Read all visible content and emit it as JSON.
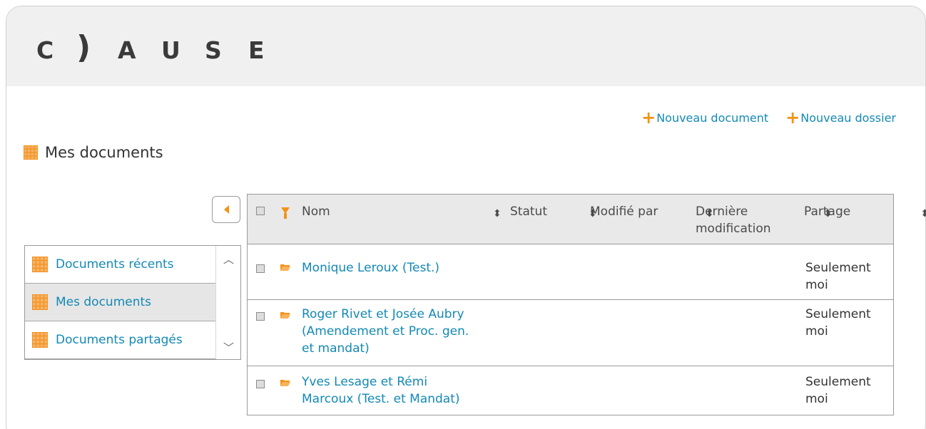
{
  "app": {
    "logo_parts": [
      "C",
      ")",
      "A",
      "U",
      "S",
      "E"
    ]
  },
  "actions": {
    "new_document": "Nouveau document",
    "new_folder": "Nouveau dossier"
  },
  "page": {
    "title": "Mes documents"
  },
  "sidebar": {
    "items": [
      {
        "label": "Documents récents",
        "active": false
      },
      {
        "label": "Mes documents",
        "active": true
      },
      {
        "label": "Documents partagés",
        "active": false
      }
    ]
  },
  "table": {
    "columns": {
      "name": "Nom",
      "status": "Statut",
      "modified_by": "Modifié par",
      "last_modified_1": "Dernière",
      "last_modified_2": "modification",
      "sharing": "Partage"
    },
    "rows": [
      {
        "name_lines": [
          "Monique Leroux (Test.)"
        ],
        "share_lines": [
          "Seulement",
          "moi"
        ]
      },
      {
        "name_lines": [
          "Roger Rivet et Josée Aubry",
          "(Amendement et Proc. gen.",
          "et mandat)"
        ],
        "share_lines": [
          "Seulement",
          "moi"
        ]
      },
      {
        "name_lines": [
          "Yves Lesage et Rémi",
          "Marcoux (Test. et Mandat)"
        ],
        "share_lines": [
          "Seulement",
          "moi"
        ]
      }
    ]
  },
  "colors": {
    "accent_orange": "#f39217",
    "link_blue": "#1389b5",
    "header_gray": "#e9e9e9"
  },
  "icons": {
    "add": "plus-icon",
    "grid": "grid-icon",
    "collapse": "caret-left-icon",
    "filter": "filter-icon",
    "sort": "sort-icon",
    "folder": "folder-open-icon",
    "up": "chevron-up-icon",
    "down": "chevron-down-icon"
  }
}
